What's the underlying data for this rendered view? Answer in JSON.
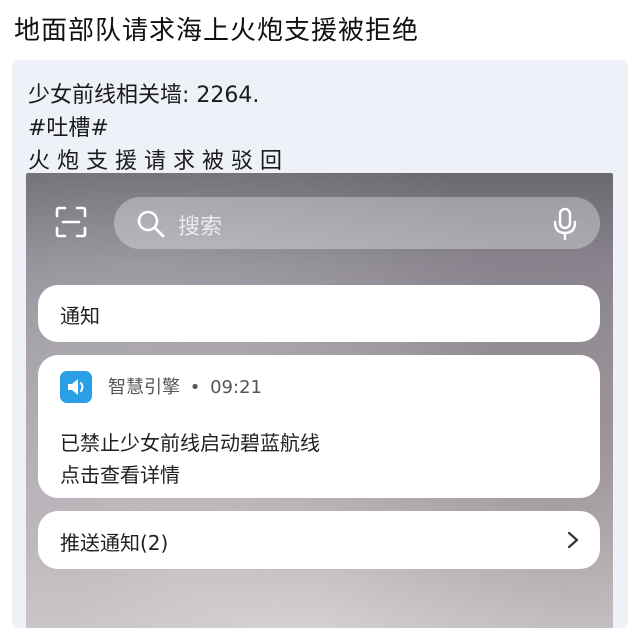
{
  "headline": "地面部队请求海上火炮支援被拒绝",
  "post": {
    "line1": "少女前线相关墙: 2264.",
    "line2": "#吐槽#",
    "line3": "火炮支援请求被驳回"
  },
  "screenshot": {
    "search": {
      "placeholder": "搜索"
    },
    "notice_card": {
      "title": "通知"
    },
    "message_card": {
      "app_name": "智慧引擎",
      "separator": "•",
      "time": "09:21",
      "line1": "已禁止少女前线启动碧蓝航线",
      "line2": "点击查看详情",
      "app_icon_color": "#2a9fe6"
    },
    "push_card": {
      "label": "推送通知(2)"
    }
  },
  "icons": [
    "scan-icon",
    "search-icon",
    "microphone-icon",
    "speaker-icon",
    "chevron-right-icon"
  ]
}
